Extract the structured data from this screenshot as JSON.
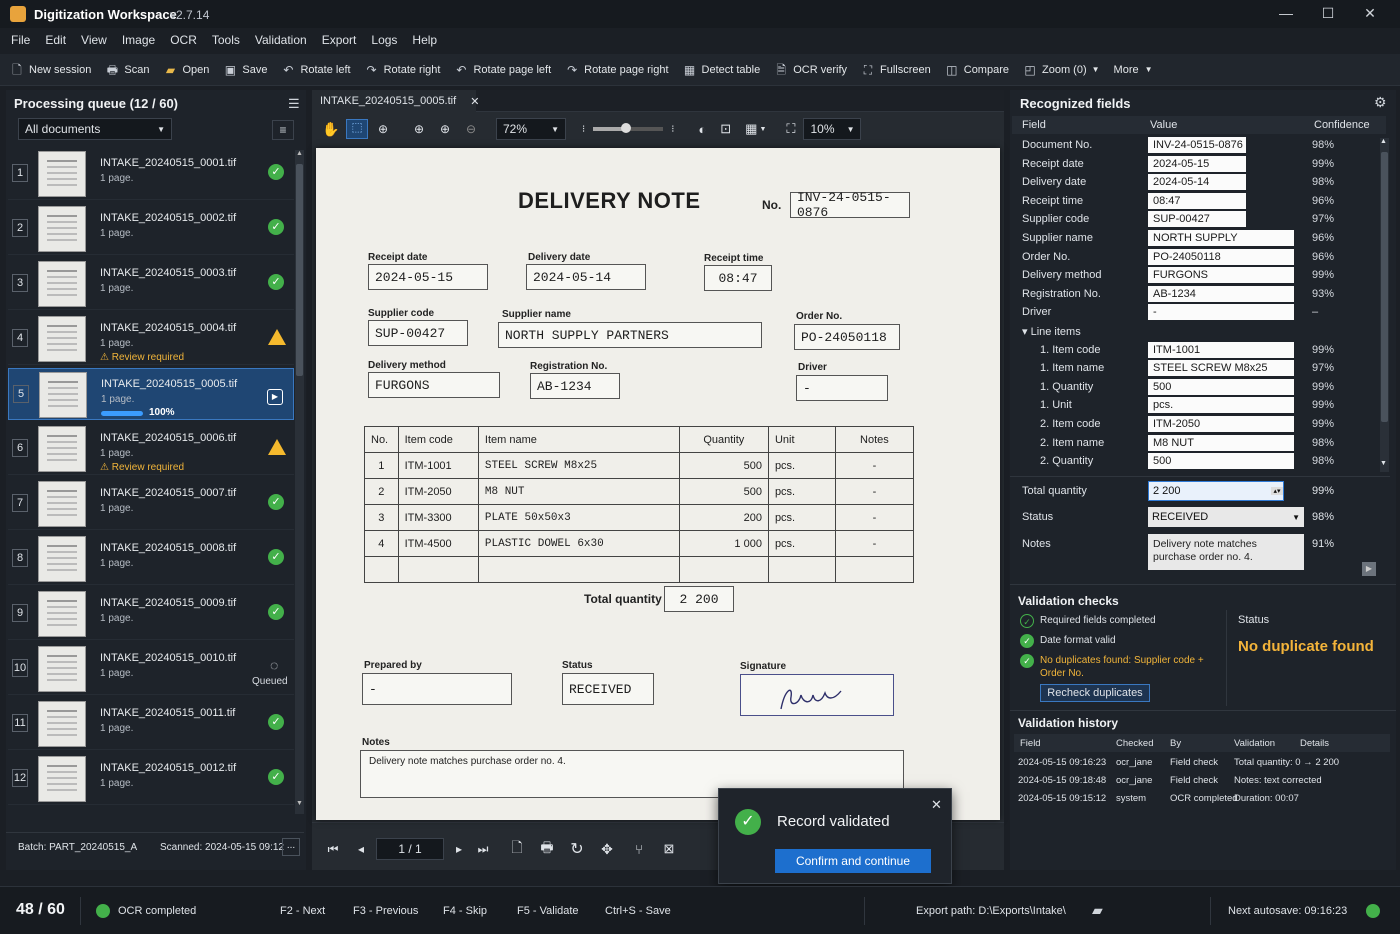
{
  "app": {
    "title": "Digitization Workspace",
    "version": "v2.7.14"
  },
  "menu": [
    "File",
    "Edit",
    "View",
    "Image",
    "OCR",
    "Tools",
    "Validation",
    "Export",
    "Logs",
    "Help"
  ],
  "toolbar": [
    "New session",
    "Scan",
    "Open",
    "Save",
    "Rotate left",
    "Rotate right",
    "Rotate page left",
    "Rotate page right",
    "Detect table",
    "OCR verify",
    "Fullscreen",
    "Compare",
    "Zoom (0)",
    "More"
  ],
  "queue": {
    "title": "Processing queue (12 / 60)",
    "filter": "All documents",
    "items": [
      {
        "num": "1",
        "name": "INTAKE_20240515_0001.tif",
        "pages": "1 page.",
        "state": "ok"
      },
      {
        "num": "2",
        "name": "INTAKE_20240515_0002.tif",
        "pages": "1 page.",
        "state": "ok"
      },
      {
        "num": "3",
        "name": "INTAKE_20240515_0003.tif",
        "pages": "1 page.",
        "state": "ok"
      },
      {
        "num": "4",
        "name": "INTAKE_20240515_0004.tif",
        "pages": "1 page.",
        "state": "warn",
        "note": "Review required"
      },
      {
        "num": "5",
        "name": "INTAKE_20240515_0005.tif",
        "pages": "1 page.",
        "state": "active",
        "progress": "100%"
      },
      {
        "num": "6",
        "name": "INTAKE_20240515_0006.tif",
        "pages": "1 page.",
        "state": "warn",
        "note": "Review required"
      },
      {
        "num": "7",
        "name": "INTAKE_20240515_0007.tif",
        "pages": "1 page.",
        "state": "ok"
      },
      {
        "num": "8",
        "name": "INTAKE_20240515_0008.tif",
        "pages": "1 page.",
        "state": "ok"
      },
      {
        "num": "9",
        "name": "INTAKE_20240515_0009.tif",
        "pages": "1 page.",
        "state": "ok"
      },
      {
        "num": "10",
        "name": "INTAKE_20240515_0010.tif",
        "pages": "1 page.",
        "state": "queued",
        "note": "Queued"
      },
      {
        "num": "11",
        "name": "INTAKE_20240515_0011.tif",
        "pages": "1 page.",
        "state": "ok"
      },
      {
        "num": "12",
        "name": "INTAKE_20240515_0012.tif",
        "pages": "1 page.",
        "state": "ok"
      }
    ],
    "batch": "Batch: PART_20240515_A",
    "scanned": "Scanned: 2024-05-15 09:12",
    "more": "..."
  },
  "viewer": {
    "tab": "INTAKE_20240515_0005.tif",
    "zoom": "72%",
    "threshold": "10%",
    "page": "1 / 1"
  },
  "doc": {
    "heading": "DELIVERY NOTE",
    "no_label": "No.",
    "no": "INV-24-0515-0876",
    "receipt_date_label": "Receipt date",
    "receipt_date": "2024-05-15",
    "delivery_date_label": "Delivery date",
    "delivery_date": "2024-05-14",
    "receipt_time_label": "Receipt time",
    "receipt_time": "08:47",
    "supplier_code_label": "Supplier code",
    "supplier_code": "SUP-00427",
    "supplier_name_label": "Supplier name",
    "supplier_name": "NORTH SUPPLY PARTNERS",
    "order_label": "Order No.",
    "order": "PO-24050118",
    "method_label": "Delivery method",
    "method": "FURGONS",
    "reg_label": "Registration No.",
    "reg": "AB-1234",
    "driver_label": "Driver",
    "driver": "-",
    "table_headers": [
      "No.",
      "Item code",
      "Item name",
      "Quantity",
      "Unit",
      "Notes"
    ],
    "rows": [
      [
        "1",
        "ITM-1001",
        "STEEL  SCREW  M8x25",
        "500",
        "pcs.",
        "-"
      ],
      [
        "2",
        "ITM-2050",
        "M8  NUT",
        "500",
        "pcs.",
        "-"
      ],
      [
        "3",
        "ITM-3300",
        "PLATE  50x50x3",
        "200",
        "pcs.",
        "-"
      ],
      [
        "4",
        "ITM-4500",
        "PLASTIC  DOWEL  6x30",
        "1 000",
        "pcs.",
        "-"
      ]
    ],
    "total_label": "Total quantity",
    "total": "2 200",
    "prepared_label": "Prepared by",
    "prepared": "-",
    "status_label": "Status",
    "status": "RECEIVED",
    "signature_label": "Signature",
    "notes_label": "Notes",
    "notes": "Delivery note matches purchase order no. 4."
  },
  "fields": {
    "title": "Recognized fields",
    "headers": [
      "Field",
      "Value",
      "Confidence"
    ],
    "rows": [
      {
        "f": "Document No.",
        "v": "INV-24-0515-0876",
        "c": "98%",
        "w": "short"
      },
      {
        "f": "Receipt date",
        "v": "2024-05-15",
        "c": "99%",
        "w": "short"
      },
      {
        "f": "Delivery date",
        "v": "2024-05-14",
        "c": "98%",
        "w": "short"
      },
      {
        "f": "Receipt time",
        "v": "08:47",
        "c": "96%",
        "w": "short"
      },
      {
        "f": "Supplier code",
        "v": "SUP-00427",
        "c": "97%",
        "w": "short"
      },
      {
        "f": "Supplier name",
        "v": "NORTH SUPPLY PARTNERS",
        "c": "96%",
        "w": "long"
      },
      {
        "f": "Order No.",
        "v": "PO-24050118",
        "c": "96%",
        "w": "long"
      },
      {
        "f": "Delivery method",
        "v": "FURGONS",
        "c": "99%",
        "w": "long"
      },
      {
        "f": "Registration No.",
        "v": "AB-1234",
        "c": "93%",
        "w": "long"
      },
      {
        "f": "Driver",
        "v": "-",
        "c": "–",
        "w": "long"
      },
      {
        "f": "▾ Line items",
        "v": "",
        "c": "",
        "w": "none"
      },
      {
        "f": "1. Item code",
        "v": "ITM-1001",
        "c": "99%",
        "w": "long"
      },
      {
        "f": "1. Item name",
        "v": "STEEL SCREW M8x25",
        "c": "97%",
        "w": "long"
      },
      {
        "f": "1. Quantity",
        "v": "500",
        "c": "99%",
        "w": "long"
      },
      {
        "f": "1. Unit",
        "v": "pcs.",
        "c": "99%",
        "w": "long"
      },
      {
        "f": "2. Item code",
        "v": "ITM-2050",
        "c": "99%",
        "w": "long"
      },
      {
        "f": "2. Item name",
        "v": "M8 NUT",
        "c": "98%",
        "w": "long"
      },
      {
        "f": "2. Quantity",
        "v": "500",
        "c": "98%",
        "w": "long"
      }
    ],
    "total_label": "Total quantity",
    "total": "2 200",
    "total_conf": "99%",
    "status_label": "Status",
    "status": "RECEIVED",
    "status_conf": "98%",
    "notes_label": "Notes",
    "notes": "Delivery note matches purchase order no. 4.",
    "notes_conf": "91%"
  },
  "validation": {
    "title": "Validation checks",
    "checks": [
      "Required fields completed",
      "Date format valid",
      "No duplicates found: Supplier code + Order No."
    ],
    "recheck": "Recheck duplicates",
    "status_label": "Status",
    "status": "No duplicate found"
  },
  "history": {
    "title": "Validation history",
    "headers": [
      "Field",
      "Checked",
      "By",
      "Validation",
      "Details"
    ],
    "rows": [
      [
        "2024-05-15 09:16:23",
        "ocr_jane",
        "Field check",
        "Total quantity: 0 → 2 200"
      ],
      [
        "2024-05-15 09:18:48",
        "ocr_jane",
        "Field check",
        "Notes: text corrected"
      ],
      [
        "2024-05-15 09:15:12",
        "system",
        "OCR completed",
        "Duration: 00:07"
      ]
    ]
  },
  "toast": {
    "message": "Record validated",
    "button": "Confirm and continue"
  },
  "status": {
    "count": "48 / 60",
    "ocr": "OCR completed",
    "keys": [
      "F2 - Next",
      "F3 - Previous",
      "F4 - Skip",
      "F5 - Validate",
      "Ctrl+S - Save"
    ],
    "export": "Export path:  D:\\Exports\\Intake\\",
    "autosave": "Next autosave: 09:16:23"
  }
}
